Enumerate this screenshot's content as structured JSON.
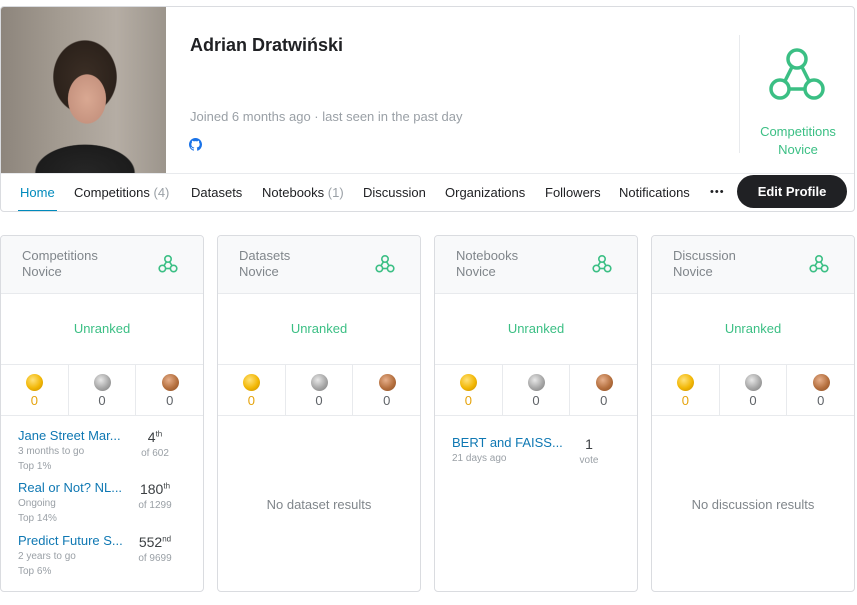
{
  "profile": {
    "name": "Adrian Dratwiński",
    "meta": "Joined 6 months ago · last seen in the past day",
    "tier_line1": "Competitions",
    "tier_line2": "Novice"
  },
  "nav": {
    "tabs": [
      {
        "label": "Home",
        "count": ""
      },
      {
        "label": "Competitions",
        "count": "(4)"
      },
      {
        "label": "Datasets",
        "count": ""
      },
      {
        "label": "Notebooks",
        "count": "(1)"
      },
      {
        "label": "Discussion",
        "count": ""
      },
      {
        "label": "Organizations",
        "count": ""
      },
      {
        "label": "Followers",
        "count": ""
      },
      {
        "label": "Notifications",
        "count": ""
      }
    ],
    "more_label": "•••",
    "edit_label": "Edit Profile"
  },
  "categories": [
    {
      "title": "Competitions",
      "tier": "Novice",
      "rank": "Unranked",
      "medals": {
        "gold": "0",
        "silver": "0",
        "bronze": "0"
      },
      "empty": "",
      "results": [
        {
          "title": "Jane Street Mar...",
          "sub1": "3 months to go",
          "sub2": "Top 1%",
          "rank": "4",
          "suffix": "th",
          "of": "of 602"
        },
        {
          "title": "Real or Not? NL...",
          "sub1": "Ongoing",
          "sub2": "Top 14%",
          "rank": "180",
          "suffix": "th",
          "of": "of 1299"
        },
        {
          "title": "Predict Future S...",
          "sub1": "2 years to go",
          "sub2": "Top 6%",
          "rank": "552",
          "suffix": "nd",
          "of": "of 9699"
        }
      ]
    },
    {
      "title": "Datasets",
      "tier": "Novice",
      "rank": "Unranked",
      "medals": {
        "gold": "0",
        "silver": "0",
        "bronze": "0"
      },
      "empty": "No dataset results",
      "results": []
    },
    {
      "title": "Notebooks",
      "tier": "Novice",
      "rank": "Unranked",
      "medals": {
        "gold": "0",
        "silver": "0",
        "bronze": "0"
      },
      "empty": "",
      "results": [
        {
          "title": "BERT and FAISS...",
          "sub1": "21 days ago",
          "sub2": "",
          "rank": "1",
          "suffix": "",
          "of": "vote"
        }
      ]
    },
    {
      "title": "Discussion",
      "tier": "Novice",
      "rank": "Unranked",
      "medals": {
        "gold": "0",
        "silver": "0",
        "bronze": "0"
      },
      "empty": "No discussion results",
      "results": []
    }
  ],
  "colors": {
    "accent": "#008abc",
    "novice": "#3bbf84",
    "gold": "#f2b705",
    "silver": "#a7a7a7",
    "bronze": "#b5703f"
  },
  "icons": [
    "github-icon",
    "novice-tier-icon",
    "gold-medal-icon",
    "silver-medal-icon",
    "bronze-medal-icon",
    "more-icon"
  ]
}
